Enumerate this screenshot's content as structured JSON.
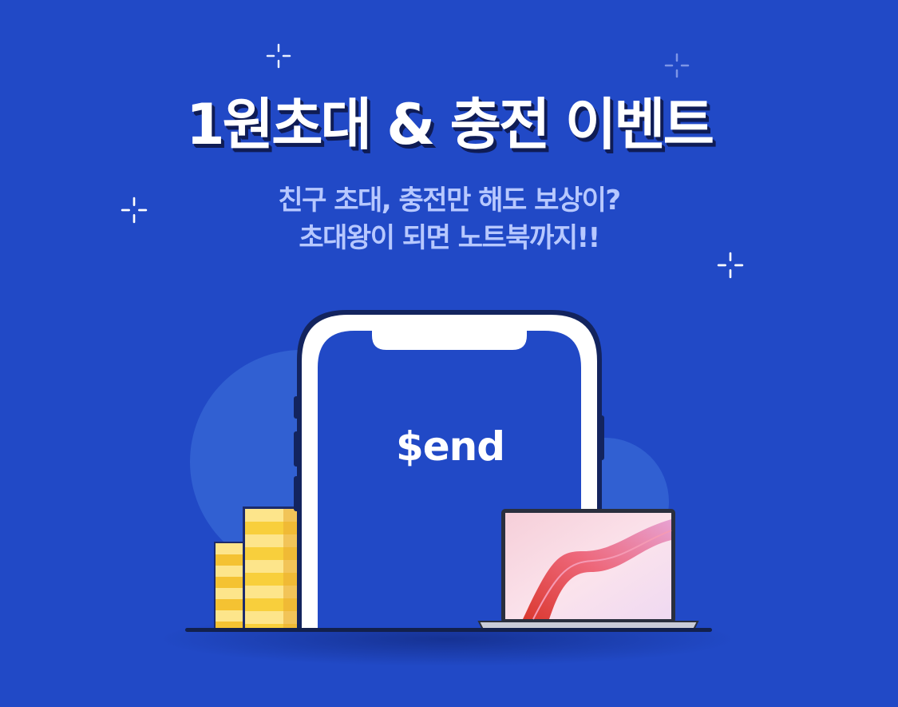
{
  "banner": {
    "title": "1원초대 & 충전 이벤트",
    "subtitle_line1": "친구 초대, 충전만 해도 보상이?",
    "subtitle_line2": "초대왕이 되면 노트북까지!!"
  },
  "phone": {
    "brand": "$end"
  },
  "icons": [
    "sparkle-icon",
    "phone-illustration",
    "coin-stack-icon",
    "laptop-illustration"
  ],
  "colors": {
    "background": "#2149c6",
    "title": "#ffffff",
    "title_shadow": "#0f1c55",
    "subtitle": "#b7c8ff",
    "coin": "#f7cf3d"
  }
}
